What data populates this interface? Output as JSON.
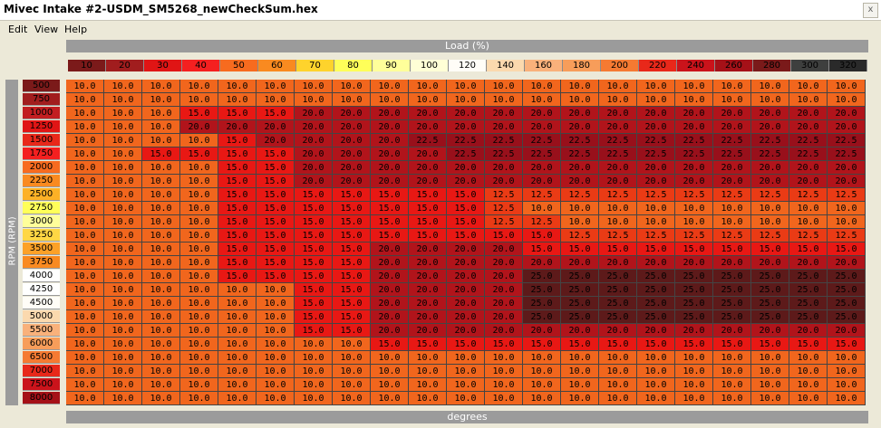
{
  "window": {
    "title": "Mivec Intake #2-USDM_SM5268_newCheckSum.hex",
    "close_glyph": "x"
  },
  "menu": [
    "Edit",
    "View",
    "Help"
  ],
  "load_label": "Load (%)",
  "bottom_label": "degrees",
  "rpm_label": "RPM (RPM)",
  "load_values": [
    "10",
    "20",
    "30",
    "40",
    "50",
    "60",
    "70",
    "80",
    "90",
    "100",
    "120",
    "140",
    "160",
    "180",
    "200",
    "220",
    "240",
    "260",
    "280",
    "300",
    "320"
  ],
  "rpm_values": [
    "500",
    "750",
    "1000",
    "1250",
    "1500",
    "1750",
    "2000",
    "2250",
    "2500",
    "2750",
    "3000",
    "3250",
    "3500",
    "3750",
    "4000",
    "4250",
    "4500",
    "5000",
    "5500",
    "6000",
    "6500",
    "7000",
    "7500",
    "8000"
  ],
  "table": [
    [
      "10.0",
      "10.0",
      "10.0",
      "10.0",
      "10.0",
      "10.0",
      "10.0",
      "10.0",
      "10.0",
      "10.0",
      "10.0",
      "10.0",
      "10.0",
      "10.0",
      "10.0",
      "10.0",
      "10.0",
      "10.0",
      "10.0",
      "10.0",
      "10.0"
    ],
    [
      "10.0",
      "10.0",
      "10.0",
      "10.0",
      "10.0",
      "10.0",
      "10.0",
      "10.0",
      "10.0",
      "10.0",
      "10.0",
      "10.0",
      "10.0",
      "10.0",
      "10.0",
      "10.0",
      "10.0",
      "10.0",
      "10.0",
      "10.0",
      "10.0"
    ],
    [
      "10.0",
      "10.0",
      "10.0",
      "15.0",
      "15.0",
      "15.0",
      "20.0",
      "20.0",
      "20.0",
      "20.0",
      "20.0",
      "20.0",
      "20.0",
      "20.0",
      "20.0",
      "20.0",
      "20.0",
      "20.0",
      "20.0",
      "20.0",
      "20.0"
    ],
    [
      "10.0",
      "10.0",
      "10.0",
      "20.0",
      "20.0",
      "20.0",
      "20.0",
      "20.0",
      "20.0",
      "20.0",
      "20.0",
      "20.0",
      "20.0",
      "20.0",
      "20.0",
      "20.0",
      "20.0",
      "20.0",
      "20.0",
      "20.0",
      "20.0"
    ],
    [
      "10.0",
      "10.0",
      "10.0",
      "10.0",
      "15.0",
      "20.0",
      "20.0",
      "20.0",
      "20.0",
      "22.5",
      "22.5",
      "22.5",
      "22.5",
      "22.5",
      "22.5",
      "22.5",
      "22.5",
      "22.5",
      "22.5",
      "22.5",
      "22.5"
    ],
    [
      "10.0",
      "10.0",
      "15.0",
      "15.0",
      "15.0",
      "15.0",
      "20.0",
      "20.0",
      "20.0",
      "20.0",
      "22.5",
      "22.5",
      "22.5",
      "22.5",
      "22.5",
      "22.5",
      "22.5",
      "22.5",
      "22.5",
      "22.5",
      "22.5"
    ],
    [
      "10.0",
      "10.0",
      "10.0",
      "10.0",
      "15.0",
      "15.0",
      "20.0",
      "20.0",
      "20.0",
      "20.0",
      "20.0",
      "20.0",
      "20.0",
      "20.0",
      "20.0",
      "20.0",
      "20.0",
      "20.0",
      "20.0",
      "20.0",
      "20.0"
    ],
    [
      "10.0",
      "10.0",
      "10.0",
      "10.0",
      "15.0",
      "15.0",
      "20.0",
      "20.0",
      "20.0",
      "20.0",
      "20.0",
      "20.0",
      "20.0",
      "20.0",
      "20.0",
      "20.0",
      "20.0",
      "20.0",
      "20.0",
      "20.0",
      "20.0"
    ],
    [
      "10.0",
      "10.0",
      "10.0",
      "10.0",
      "15.0",
      "15.0",
      "15.0",
      "15.0",
      "15.0",
      "15.0",
      "15.0",
      "12.5",
      "12.5",
      "12.5",
      "12.5",
      "12.5",
      "12.5",
      "12.5",
      "12.5",
      "12.5",
      "12.5"
    ],
    [
      "10.0",
      "10.0",
      "10.0",
      "10.0",
      "15.0",
      "15.0",
      "15.0",
      "15.0",
      "15.0",
      "15.0",
      "15.0",
      "12.5",
      "10.0",
      "10.0",
      "10.0",
      "10.0",
      "10.0",
      "10.0",
      "10.0",
      "10.0",
      "10.0"
    ],
    [
      "10.0",
      "10.0",
      "10.0",
      "10.0",
      "15.0",
      "15.0",
      "15.0",
      "15.0",
      "15.0",
      "15.0",
      "15.0",
      "12.5",
      "12.5",
      "10.0",
      "10.0",
      "10.0",
      "10.0",
      "10.0",
      "10.0",
      "10.0",
      "10.0"
    ],
    [
      "10.0",
      "10.0",
      "10.0",
      "10.0",
      "15.0",
      "15.0",
      "15.0",
      "15.0",
      "15.0",
      "15.0",
      "15.0",
      "15.0",
      "15.0",
      "12.5",
      "12.5",
      "12.5",
      "12.5",
      "12.5",
      "12.5",
      "12.5",
      "12.5"
    ],
    [
      "10.0",
      "10.0",
      "10.0",
      "10.0",
      "15.0",
      "15.0",
      "15.0",
      "15.0",
      "20.0",
      "20.0",
      "20.0",
      "20.0",
      "15.0",
      "15.0",
      "15.0",
      "15.0",
      "15.0",
      "15.0",
      "15.0",
      "15.0",
      "15.0"
    ],
    [
      "10.0",
      "10.0",
      "10.0",
      "10.0",
      "15.0",
      "15.0",
      "15.0",
      "15.0",
      "20.0",
      "20.0",
      "20.0",
      "20.0",
      "20.0",
      "20.0",
      "20.0",
      "20.0",
      "20.0",
      "20.0",
      "20.0",
      "20.0",
      "20.0"
    ],
    [
      "10.0",
      "10.0",
      "10.0",
      "10.0",
      "15.0",
      "15.0",
      "15.0",
      "15.0",
      "20.0",
      "20.0",
      "20.0",
      "20.0",
      "25.0",
      "25.0",
      "25.0",
      "25.0",
      "25.0",
      "25.0",
      "25.0",
      "25.0",
      "25.0"
    ],
    [
      "10.0",
      "10.0",
      "10.0",
      "10.0",
      "10.0",
      "10.0",
      "15.0",
      "15.0",
      "20.0",
      "20.0",
      "20.0",
      "20.0",
      "25.0",
      "25.0",
      "25.0",
      "25.0",
      "25.0",
      "25.0",
      "25.0",
      "25.0",
      "25.0"
    ],
    [
      "10.0",
      "10.0",
      "10.0",
      "10.0",
      "10.0",
      "10.0",
      "15.0",
      "15.0",
      "20.0",
      "20.0",
      "20.0",
      "20.0",
      "25.0",
      "25.0",
      "25.0",
      "25.0",
      "25.0",
      "25.0",
      "25.0",
      "25.0",
      "25.0"
    ],
    [
      "10.0",
      "10.0",
      "10.0",
      "10.0",
      "10.0",
      "10.0",
      "15.0",
      "15.0",
      "20.0",
      "20.0",
      "20.0",
      "20.0",
      "25.0",
      "25.0",
      "25.0",
      "25.0",
      "25.0",
      "25.0",
      "25.0",
      "25.0",
      "25.0"
    ],
    [
      "10.0",
      "10.0",
      "10.0",
      "10.0",
      "10.0",
      "10.0",
      "15.0",
      "15.0",
      "20.0",
      "20.0",
      "20.0",
      "20.0",
      "20.0",
      "20.0",
      "20.0",
      "20.0",
      "20.0",
      "20.0",
      "20.0",
      "20.0",
      "20.0"
    ],
    [
      "10.0",
      "10.0",
      "10.0",
      "10.0",
      "10.0",
      "10.0",
      "10.0",
      "10.0",
      "15.0",
      "15.0",
      "15.0",
      "15.0",
      "15.0",
      "15.0",
      "15.0",
      "15.0",
      "15.0",
      "15.0",
      "15.0",
      "15.0",
      "15.0"
    ],
    [
      "10.0",
      "10.0",
      "10.0",
      "10.0",
      "10.0",
      "10.0",
      "10.0",
      "10.0",
      "10.0",
      "10.0",
      "10.0",
      "10.0",
      "10.0",
      "10.0",
      "10.0",
      "10.0",
      "10.0",
      "10.0",
      "10.0",
      "10.0",
      "10.0"
    ],
    [
      "10.0",
      "10.0",
      "10.0",
      "10.0",
      "10.0",
      "10.0",
      "10.0",
      "10.0",
      "10.0",
      "10.0",
      "10.0",
      "10.0",
      "10.0",
      "10.0",
      "10.0",
      "10.0",
      "10.0",
      "10.0",
      "10.0",
      "10.0",
      "10.0"
    ],
    [
      "10.0",
      "10.0",
      "10.0",
      "10.0",
      "10.0",
      "10.0",
      "10.0",
      "10.0",
      "10.0",
      "10.0",
      "10.0",
      "10.0",
      "10.0",
      "10.0",
      "10.0",
      "10.0",
      "10.0",
      "10.0",
      "10.0",
      "10.0",
      "10.0"
    ],
    [
      "10.0",
      "10.0",
      "10.0",
      "10.0",
      "10.0",
      "10.0",
      "10.0",
      "10.0",
      "10.0",
      "10.0",
      "10.0",
      "10.0",
      "10.0",
      "10.0",
      "10.0",
      "10.0",
      "10.0",
      "10.0",
      "10.0",
      "10.0",
      "10.0"
    ]
  ],
  "colors": {
    "value_10": "#f1661d",
    "value_12.5": "#ea3b15",
    "value_15": "#e81814",
    "value_20": "#b1141b",
    "value_22.5": "#98101b",
    "value_25": "#5d1a1a",
    "load_scale": [
      "#7b1a1a",
      "#a11d1e",
      "#e01515",
      "#f42020",
      "#f76b1f",
      "#f98a20",
      "#fed32c",
      "#ffff59",
      "#ffff9a",
      "#ffffd6",
      "#fffdf7",
      "#fbd9ae",
      "#f9b17b",
      "#f79d5a",
      "#f57a32",
      "#e8281a",
      "#ca131b",
      "#a51118",
      "#7a1a1a",
      "#3e3f3e",
      "#2a2a2a"
    ],
    "rpm_scale": [
      "#7b1a1a",
      "#a11d1e",
      "#c21e21",
      "#e01515",
      "#e8281a",
      "#f42020",
      "#f76b1f",
      "#f98a20",
      "#fdb126",
      "#ffff59",
      "#ffff9a",
      "#ffd744",
      "#fca128",
      "#f98a20",
      "#ffffff",
      "#ffffff",
      "#fffdf7",
      "#fbd9ae",
      "#f9b17b",
      "#f79d5a",
      "#f57a32",
      "#e8281a",
      "#ca131b",
      "#a51118"
    ]
  }
}
